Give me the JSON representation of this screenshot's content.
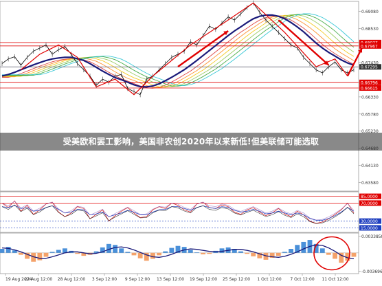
{
  "headline": "受美欧和罢工影响，美国非农创2020年以来新低!但美联储可能选取",
  "colors": {
    "price": "#000000",
    "ma_main": "#1a1a7a",
    "ma_ribbon": [
      "#d62728",
      "#ff7f0e",
      "#f2c200",
      "#8bc34a",
      "#2ca02c",
      "#17becf"
    ],
    "hline_red": "#e00000",
    "hline_blue": "#2040c0",
    "arrow": "#e00000",
    "osc_lines": [
      "#d62728",
      "#1f3fbf",
      "#9467bd",
      "#000000"
    ],
    "hist_pos": "#4a90d9",
    "hist_neg": "#f4a26a",
    "signal": "#1a1a7a",
    "circle": "#e00000"
  },
  "chart_data": [
    {
      "type": "line",
      "panel": "price",
      "x_ticks": [
        "19 Aug 2024",
        "22 Aug 12:00",
        "28 Aug 12:00",
        "3 Sep 12:00",
        "9 Sep 12:00",
        "13 Sep 12:00",
        "19 Sep 12:00",
        "25 Sep 12:00",
        "1 Oct 12:00",
        "7 Oct 12:00",
        "11 Oct 12:00"
      ],
      "y_ticks": [
        0.6908,
        0.6853,
        0.6743,
        0.6633,
        0.6578,
        0.6523,
        0.6468,
        0.6413,
        0.6358
      ],
      "ylim": [
        0.633,
        0.694
      ],
      "horizontal_levels": [
        {
          "value": 0.68077,
          "label": "0.68077",
          "color": "red"
        },
        {
          "value": 0.67967,
          "label": "0.67967",
          "color": "red"
        },
        {
          "value": 0.67295,
          "label": "0.67295",
          "color": "dark"
        },
        {
          "value": 0.66796,
          "label": "0.66796",
          "color": "red"
        },
        {
          "value": 0.66615,
          "label": "0.66615",
          "color": "red"
        }
      ],
      "series": [
        {
          "values": [
            0.674,
            0.6755,
            0.6762,
            0.6735,
            0.676,
            0.678,
            0.679,
            0.68,
            0.677,
            0.6785,
            0.6795,
            0.677,
            0.674,
            0.672,
            0.67,
            0.667,
            0.669,
            0.668,
            0.67,
            0.6705,
            0.666,
            0.665,
            0.664,
            0.669,
            0.67,
            0.672,
            0.674,
            0.676,
            0.677,
            0.678,
            0.681,
            0.68,
            0.683,
            0.686,
            0.685,
            0.687,
            0.689,
            0.688,
            0.69,
            0.692,
            0.6935,
            0.6905,
            0.688,
            0.686,
            0.684,
            0.682,
            0.68,
            0.679,
            0.676,
            0.674,
            0.672,
            0.671,
            0.673,
            0.6745,
            0.672,
            0.671,
            0.672
          ]
        },
        {
          "values": [
            0.67,
            0.6705,
            0.6712,
            0.672,
            0.6728,
            0.6736,
            0.6743,
            0.675,
            0.6755,
            0.6758,
            0.676,
            0.676,
            0.6756,
            0.675,
            0.674,
            0.6728,
            0.6716,
            0.6705,
            0.6695,
            0.6688,
            0.668,
            0.6672,
            0.6666,
            0.6665,
            0.6668,
            0.6675,
            0.6685,
            0.6696,
            0.6708,
            0.672,
            0.6735,
            0.675,
            0.6766,
            0.6782,
            0.6798,
            0.6814,
            0.683,
            0.6845,
            0.6858,
            0.6872,
            0.6884,
            0.6892,
            0.6896,
            0.6896,
            0.6892,
            0.6884,
            0.6872,
            0.6858,
            0.6842,
            0.6824,
            0.6806,
            0.679,
            0.6776,
            0.6764,
            0.6752,
            0.6742,
            0.6735
          ]
        }
      ]
    },
    {
      "type": "line",
      "panel": "oscillator",
      "y_ticks": [
        85.0,
        70.0,
        30.0,
        15.0
      ],
      "ylim": [
        5,
        95
      ],
      "horizontal_levels": [
        {
          "value": 85.0,
          "label": "85.0000",
          "color": "red"
        },
        {
          "value": 70.0,
          "label": "70.0000",
          "color": "red"
        },
        {
          "value": 30.0,
          "label": "30.0000",
          "color": "blue"
        },
        {
          "value": 15.0,
          "label": "15.0000",
          "color": "blue"
        }
      ],
      "series": [
        {
          "values": [
            70,
            60,
            75,
            52,
            65,
            45,
            55,
            68,
            72,
            50,
            40,
            48,
            62,
            58,
            35,
            45,
            55,
            30,
            42,
            52,
            60,
            48,
            38,
            40,
            55,
            62,
            58,
            70,
            65,
            55,
            50,
            68,
            72,
            60,
            58,
            66,
            62,
            50,
            45,
            55,
            60,
            50,
            42,
            48,
            58,
            46,
            40,
            52,
            44,
            30,
            25,
            28,
            35,
            45,
            55,
            70,
            48
          ]
        },
        {
          "values": [
            62,
            60,
            65,
            58,
            60,
            52,
            54,
            60,
            64,
            56,
            48,
            50,
            56,
            55,
            44,
            46,
            50,
            40,
            44,
            48,
            54,
            50,
            44,
            44,
            50,
            55,
            56,
            62,
            62,
            58,
            54,
            60,
            64,
            60,
            58,
            62,
            60,
            54,
            50,
            52,
            56,
            52,
            46,
            48,
            52,
            48,
            44,
            48,
            44,
            36,
            32,
            32,
            36,
            42,
            50,
            60,
            52
          ]
        }
      ]
    },
    {
      "type": "bar",
      "panel": "histogram",
      "y_ticks": [
        0.0033858,
        -0.0036965
      ],
      "ylim": [
        -0.0042,
        0.004
      ],
      "axis_labels": [
        "0.0033858",
        "-0.0036965"
      ],
      "series": [
        {
          "values": [
            0.0008,
            0.0012,
            0.0005,
            -0.0004,
            -0.0012,
            -0.0018,
            -0.0015,
            -0.0008,
            0.0002,
            0.0006,
            0.0009,
            0.0004,
            -0.0002,
            -0.0006,
            -0.0004,
            0.0003,
            0.0011,
            0.0018,
            0.0016,
            0.0009,
            0.0002,
            -0.0005,
            -0.0011,
            -0.0016,
            -0.0012,
            -0.0005,
            0.0003,
            0.001,
            0.0014,
            0.0012,
            0.0006,
            0.0001,
            -0.0003,
            -0.0002,
            0.0004,
            0.0009,
            0.0011,
            0.0008,
            0.0003,
            -0.0002,
            -0.0007,
            -0.0011,
            -0.0014,
            -0.001,
            -0.0006,
            0.0002,
            0.0008,
            0.0016,
            0.0022,
            0.0026,
            0.0018,
            0.0009,
            -0.0004,
            -0.0012,
            -0.002,
            -0.0016,
            -0.0008
          ]
        },
        {
          "values": [
            0.001,
            0.0009,
            0.0006,
            0.0002,
            -0.0003,
            -0.0008,
            -0.0011,
            -0.0011,
            -0.0008,
            -0.0004,
            0.0,
            0.0002,
            0.0002,
            0.0,
            -0.0002,
            -0.0001,
            0.0002,
            0.0007,
            0.0011,
            0.0012,
            0.001,
            0.0006,
            0.0001,
            -0.0004,
            -0.0008,
            -0.0009,
            -0.0007,
            -0.0003,
            0.0002,
            0.0006,
            0.0008,
            0.0007,
            0.0005,
            0.0003,
            0.0002,
            0.0003,
            0.0005,
            0.0007,
            0.0007,
            0.0005,
            0.0002,
            -0.0002,
            -0.0006,
            -0.0008,
            -0.0009,
            -0.0007,
            -0.0003,
            0.0002,
            0.0008,
            0.0013,
            0.0016,
            0.0015,
            0.001,
            0.0003,
            -0.0005,
            -0.001,
            -0.0012
          ]
        }
      ]
    }
  ]
}
